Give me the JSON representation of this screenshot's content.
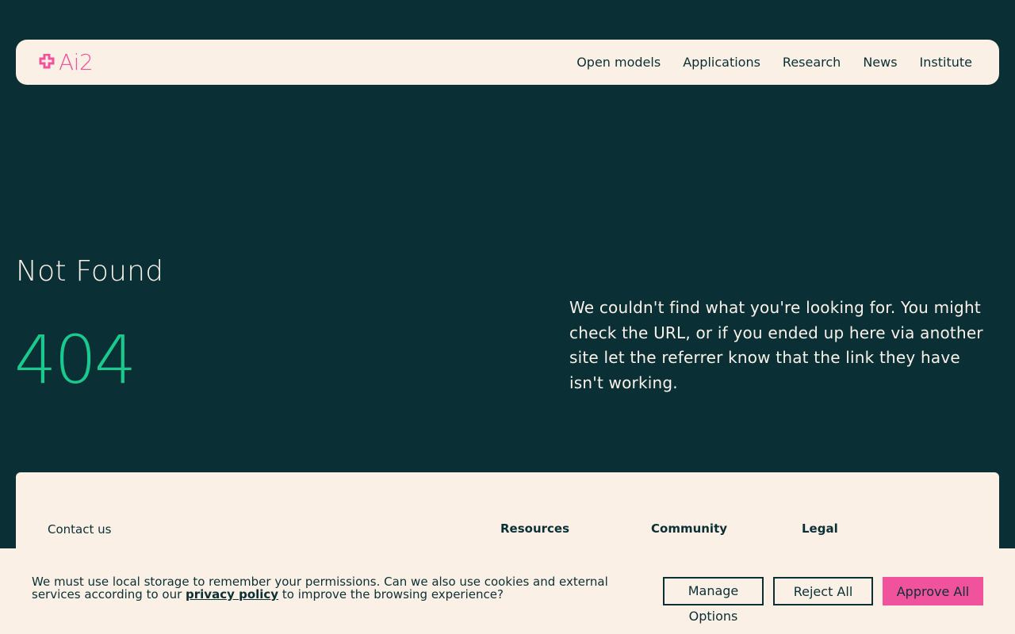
{
  "header": {
    "logo_text": "Ai2",
    "logo_icon": "ai2-sparkle-icon",
    "nav": [
      {
        "label": "Open models"
      },
      {
        "label": "Applications"
      },
      {
        "label": "Research"
      },
      {
        "label": "News"
      },
      {
        "label": "Institute"
      }
    ]
  },
  "main": {
    "title": "Not Found",
    "code": "404",
    "description": "We couldn't find what you're looking for. You might check the URL, or if you ended up here via another site let the referrer know that the link they have isn't working."
  },
  "footer": {
    "contact_label": "Contact us",
    "columns": [
      "Resources",
      "Community",
      "Legal"
    ]
  },
  "cookie_banner": {
    "text_before": "We must use local storage to remember your permissions. Can we also use cookies and external services according to our ",
    "link_text": "privacy policy",
    "text_after": " to improve the browsing experience?",
    "manage_label": "Manage",
    "manage_label_2": "Options",
    "reject_label": "Reject All",
    "approve_label": "Approve All"
  },
  "colors": {
    "background": "#0a3035",
    "cream": "#faf0e6",
    "brand_pink": "#f0529c",
    "accent_green": "#1ac98e"
  }
}
